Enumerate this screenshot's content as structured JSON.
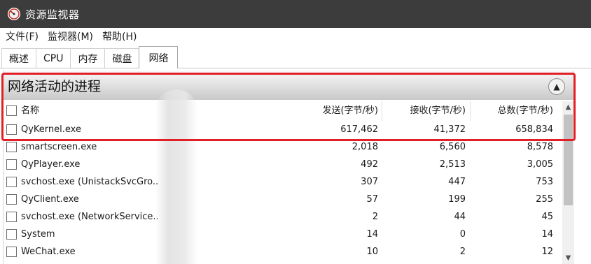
{
  "window": {
    "title": "资源监视器"
  },
  "menu": [
    "文件(F)",
    "监视器(M)",
    "帮助(H)"
  ],
  "tabs": [
    {
      "label": "概述",
      "active": false
    },
    {
      "label": "CPU",
      "active": false
    },
    {
      "label": "内存",
      "active": false
    },
    {
      "label": "磁盘",
      "active": false
    },
    {
      "label": "网络",
      "active": true
    }
  ],
  "section": {
    "title": "网络活动的进程",
    "collapse_icon": "chevron-up-icon"
  },
  "columns": {
    "name": "名称",
    "send": "发送(字节/秒)",
    "recv": "接收(字节/秒)",
    "total": "总数(字节/秒)"
  },
  "processes": [
    {
      "name": "QyKernel.exe",
      "send": "617,462",
      "recv": "41,372",
      "total": "658,834"
    },
    {
      "name": "smartscreen.exe",
      "send": "2,018",
      "recv": "6,560",
      "total": "8,578"
    },
    {
      "name": "QyPlayer.exe",
      "send": "492",
      "recv": "2,513",
      "total": "3,005"
    },
    {
      "name": "svchost.exe (UnistackSvcGro...",
      "send": "307",
      "recv": "447",
      "total": "753"
    },
    {
      "name": "QyClient.exe",
      "send": "57",
      "recv": "199",
      "total": "255"
    },
    {
      "name": "svchost.exe (NetworkService...",
      "send": "2",
      "recv": "44",
      "total": "45"
    },
    {
      "name": "System",
      "send": "14",
      "recv": "0",
      "total": "14"
    },
    {
      "name": "WeChat.exe",
      "send": "10",
      "recv": "2",
      "total": "12"
    }
  ],
  "colors": {
    "titlebar": "#3c3c3c",
    "highlight": "#e21f26"
  }
}
